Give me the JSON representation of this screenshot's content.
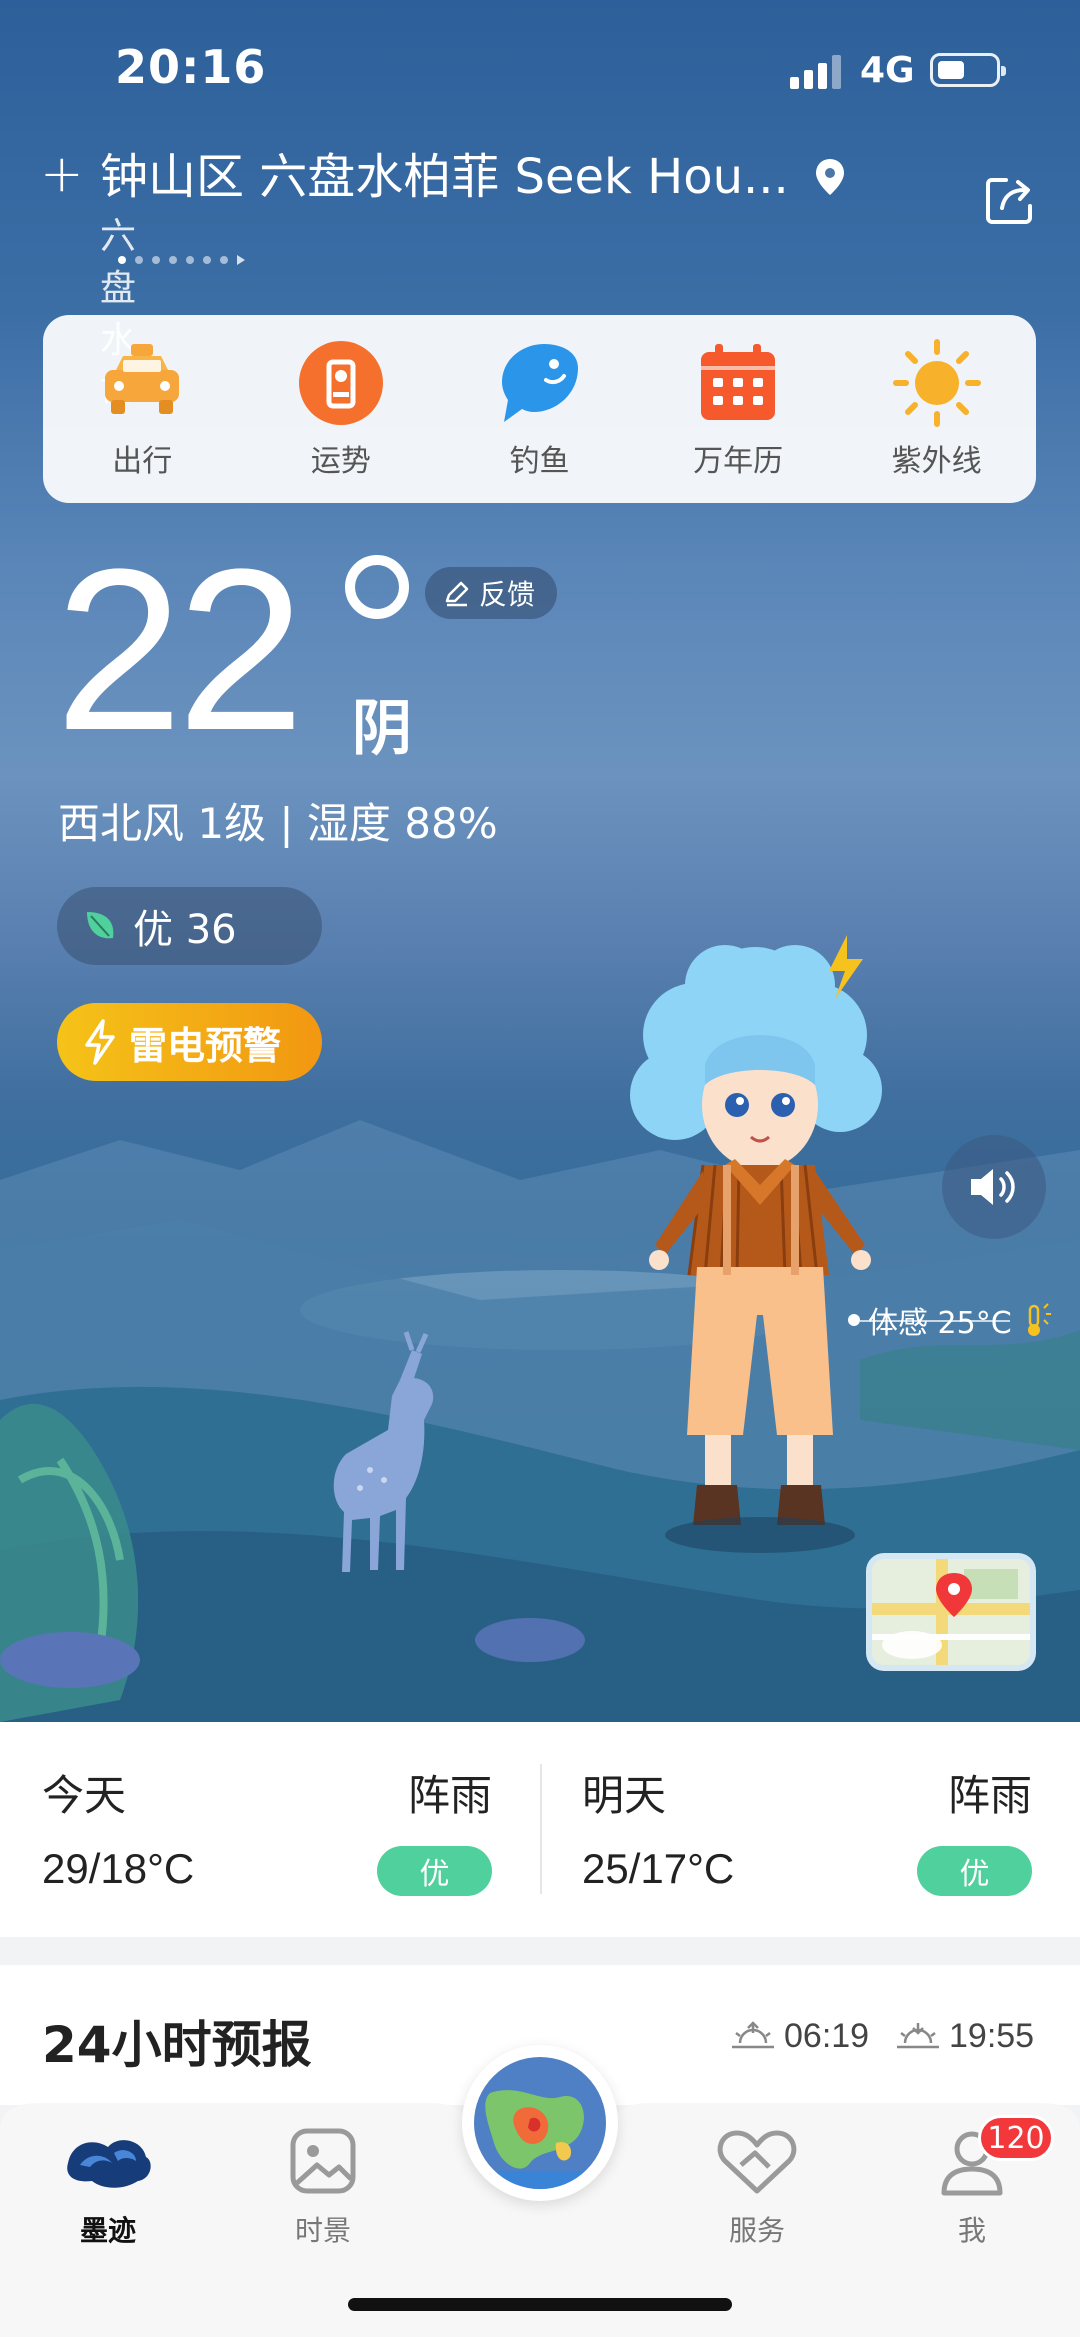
{
  "status": {
    "time": "20:16",
    "network": "4G"
  },
  "location": {
    "title": "钟山区 六盘水柏菲 Seek Hou...",
    "city": "六盘水市",
    "page_count": 7,
    "active_page": 1
  },
  "quick_actions": [
    {
      "label": "出行",
      "icon": "taxi-icon"
    },
    {
      "label": "运势",
      "icon": "fortune-icon"
    },
    {
      "label": "钓鱼",
      "icon": "fish-icon"
    },
    {
      "label": "万年历",
      "icon": "calendar-icon"
    },
    {
      "label": "紫外线",
      "icon": "sun-icon"
    }
  ],
  "current": {
    "temperature": "22",
    "condition": "阴",
    "feedback_label": "反馈",
    "wind_humidity": "西北风 1级 | 湿度 88%",
    "aqi_label": "优 36",
    "warning_label": "雷电预警",
    "feels_like": "体感 25°C"
  },
  "daily": [
    {
      "name": "今天",
      "weather": "阵雨",
      "range": "29/18°C",
      "aqi": "优"
    },
    {
      "name": "明天",
      "weather": "阵雨",
      "range": "25/17°C",
      "aqi": "优"
    }
  ],
  "hourly": {
    "title": "24小时预报",
    "sunrise": "06:19",
    "sunset": "19:55"
  },
  "tabs": [
    {
      "label": "墨迹",
      "active": true
    },
    {
      "label": "时景",
      "active": false
    },
    {
      "label": "服务",
      "active": false
    },
    {
      "label": "我",
      "active": false
    }
  ],
  "notifications": {
    "count": "120"
  },
  "colors": {
    "aqi_good": "#4fd09c",
    "warning": "#f29711",
    "badge": "#f2383b"
  }
}
